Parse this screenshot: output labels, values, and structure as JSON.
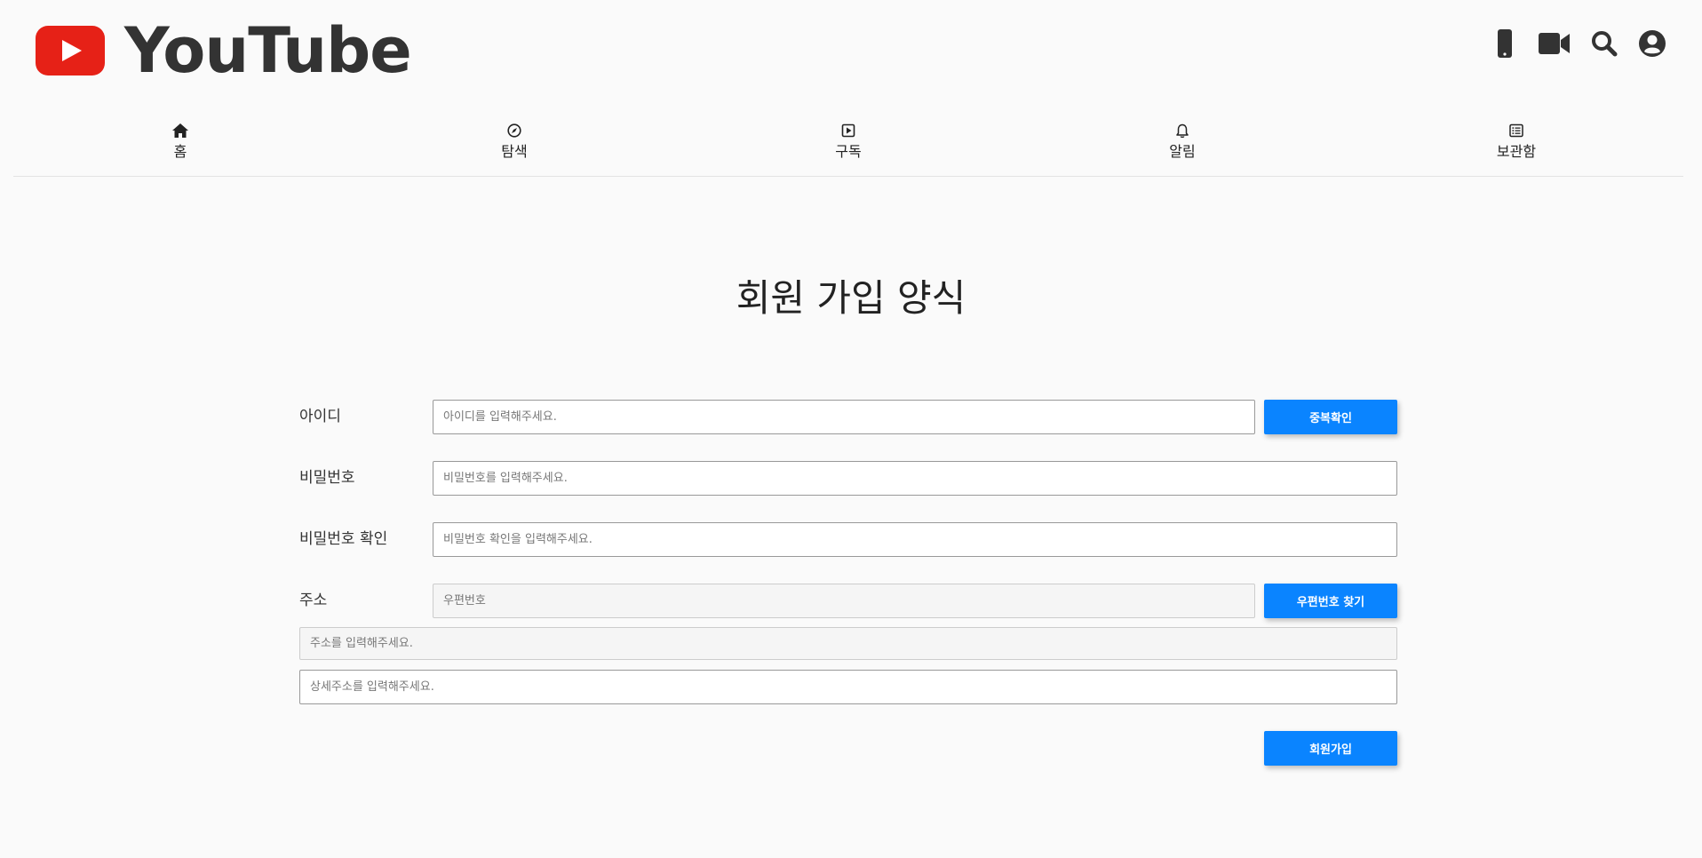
{
  "header": {
    "logo_text": "YouTube",
    "icons": [
      "mobile-icon",
      "video-camera-icon",
      "search-icon",
      "account-icon"
    ]
  },
  "nav": {
    "items": [
      {
        "label": "홈",
        "icon": "home-icon"
      },
      {
        "label": "탐색",
        "icon": "compass-icon"
      },
      {
        "label": "구독",
        "icon": "subscriptions-icon"
      },
      {
        "label": "알림",
        "icon": "bell-icon"
      },
      {
        "label": "보관함",
        "icon": "library-icon"
      }
    ]
  },
  "form": {
    "title": "회원 가입 양식",
    "id": {
      "label": "아이디",
      "placeholder": "아이디를 입력해주세요.",
      "button": "중복확인"
    },
    "password": {
      "label": "비밀번호",
      "placeholder": "비밀번호를 입력해주세요."
    },
    "password_confirm": {
      "label": "비밀번호 확인",
      "placeholder": "비밀번호 확인을 입력해주세요."
    },
    "address": {
      "label": "주소",
      "zip_placeholder": "우편번호",
      "zip_button": "우편번호 찾기",
      "address_placeholder": "주소를 입력해주세요.",
      "detail_placeholder": "상세주소를 입력해주세요."
    },
    "submit": "회원가입"
  },
  "colors": {
    "accent": "#0a84ff",
    "logo_red": "#e62117",
    "background": "#fafafa"
  }
}
